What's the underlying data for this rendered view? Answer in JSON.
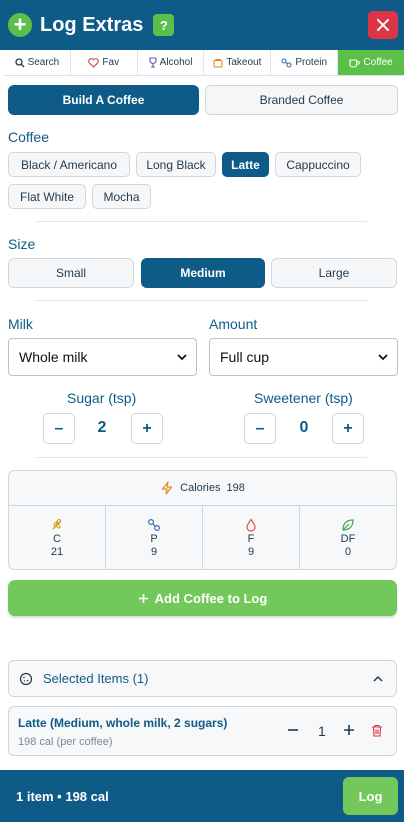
{
  "header": {
    "title": "Log Extras",
    "help_label": "?"
  },
  "tabs": [
    {
      "label": "Search",
      "icon": "search-icon"
    },
    {
      "label": "Fav",
      "icon": "heart-icon"
    },
    {
      "label": "Alcohol",
      "icon": "wine-icon"
    },
    {
      "label": "Takeout",
      "icon": "takeout-icon"
    },
    {
      "label": "Protein",
      "icon": "protein-icon"
    },
    {
      "label": "Coffee",
      "icon": "coffee-icon",
      "active": true
    }
  ],
  "mode": {
    "build": "Build A Coffee",
    "branded": "Branded Coffee"
  },
  "coffee": {
    "label": "Coffee",
    "options": [
      "Black / Americano",
      "Long Black",
      "Latte",
      "Cappuccino",
      "Flat White",
      "Mocha"
    ],
    "selected": "Latte"
  },
  "size": {
    "label": "Size",
    "options": [
      "Small",
      "Medium",
      "Large"
    ],
    "selected": "Medium"
  },
  "milk": {
    "label": "Milk",
    "value": "Whole milk"
  },
  "amount": {
    "label": "Amount",
    "value": "Full cup"
  },
  "sugar": {
    "label": "Sugar (tsp)",
    "value": "2",
    "minus": "–",
    "plus": "+"
  },
  "sweetener": {
    "label": "Sweetener (tsp)",
    "value": "0",
    "minus": "–",
    "plus": "+"
  },
  "nutrition": {
    "calories_label": "Calories",
    "calories_value": "198",
    "macros": [
      {
        "label": "C",
        "value": "21",
        "icon": "wheat-icon",
        "color": "#d99a1c"
      },
      {
        "label": "P",
        "value": "9",
        "icon": "protein-icon",
        "color": "#3a6fb0"
      },
      {
        "label": "F",
        "value": "9",
        "icon": "drop-icon",
        "color": "#d9534f"
      },
      {
        "label": "DF",
        "value": "0",
        "icon": "leaf-icon",
        "color": "#3fa34d"
      }
    ]
  },
  "add_button": "Add Coffee to Log",
  "selected_items": {
    "title": "Selected Items (1)",
    "items": [
      {
        "name": "Latte (Medium, whole milk, 2 sugars)",
        "sub": "198 cal (per coffee)",
        "qty": "1"
      }
    ]
  },
  "footer": {
    "summary": "1 item • 198 cal",
    "log_label": "Log"
  },
  "colors": {
    "primary": "#0f5b87",
    "accent": "#5cbf4a",
    "danger": "#dc3545"
  }
}
